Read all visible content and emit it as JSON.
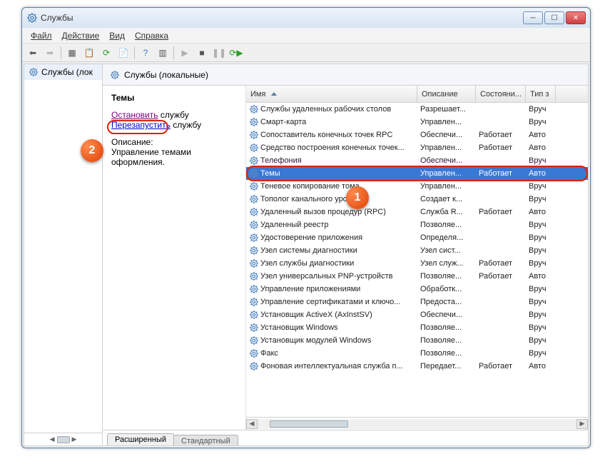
{
  "title": "Службы",
  "menu": [
    "Файл",
    "Действие",
    "Вид",
    "Справка"
  ],
  "leftpane": {
    "label": "Службы (лок"
  },
  "rp_header": "Службы (локальные)",
  "tabs": {
    "active": "Расширенный",
    "inactive": "Стандартный"
  },
  "detail": {
    "name": "Темы",
    "stop_text": "Остановить",
    "restart_text": "Перезапустить",
    "suffix": " службу",
    "desc_label": "Описание:",
    "desc": "Управление темами оформления."
  },
  "columns": [
    "Имя",
    "Описание",
    "Состояни...",
    "Тип з"
  ],
  "badges": {
    "b1": "1",
    "b2": "2"
  },
  "services": [
    {
      "name": "Службы удаленных рабочих столов",
      "desc": "Разрешает...",
      "stat": "",
      "type": "Вруч"
    },
    {
      "name": "Смарт-карта",
      "desc": "Управлен...",
      "stat": "",
      "type": "Вруч"
    },
    {
      "name": "Сопоставитель конечных точек RPC",
      "desc": "Обеспечи...",
      "stat": "Работает",
      "type": "Авто"
    },
    {
      "name": "Средство построения конечных точек...",
      "desc": "Управлен...",
      "stat": "Работает",
      "type": "Авто"
    },
    {
      "name": "Телефония",
      "desc": "Обеспечи...",
      "stat": "",
      "type": "Вруч"
    },
    {
      "name": "Темы",
      "desc": "Управлен...",
      "stat": "Работает",
      "type": "Авто",
      "selected": true
    },
    {
      "name": "Теневое копирование тома",
      "desc": "Управлен...",
      "stat": "",
      "type": "Вруч"
    },
    {
      "name": "Тополог канального уровня",
      "desc": "Создает к...",
      "stat": "",
      "type": "Вруч"
    },
    {
      "name": "Удаленный вызов процедур (RPC)",
      "desc": "Служба R...",
      "stat": "Работает",
      "type": "Авто"
    },
    {
      "name": "Удаленный реестр",
      "desc": "Позволяе...",
      "stat": "",
      "type": "Вруч"
    },
    {
      "name": "Удостоверение приложения",
      "desc": "Определя...",
      "stat": "",
      "type": "Вруч"
    },
    {
      "name": "Узел системы диагностики",
      "desc": "Узел сист...",
      "stat": "",
      "type": "Вруч"
    },
    {
      "name": "Узел службы диагностики",
      "desc": "Узел служ...",
      "stat": "Работает",
      "type": "Вруч"
    },
    {
      "name": "Узел универсальных PNP-устройств",
      "desc": "Позволяе...",
      "stat": "Работает",
      "type": "Авто"
    },
    {
      "name": "Управление приложениями",
      "desc": "Обработк...",
      "stat": "",
      "type": "Вруч"
    },
    {
      "name": "Управление сертификатами и ключо...",
      "desc": "Предоста...",
      "stat": "",
      "type": "Вруч"
    },
    {
      "name": "Установщик ActiveX (AxInstSV)",
      "desc": "Обеспечи...",
      "stat": "",
      "type": "Вруч"
    },
    {
      "name": "Установщик Windows",
      "desc": "Позволяе...",
      "stat": "",
      "type": "Вруч"
    },
    {
      "name": "Установщик модулей Windows",
      "desc": "Позволяе...",
      "stat": "",
      "type": "Вруч"
    },
    {
      "name": "Факс",
      "desc": "Позволяе...",
      "stat": "",
      "type": "Вруч"
    },
    {
      "name": "Фоновая интеллектуальная служба п...",
      "desc": "Передает...",
      "stat": "Работает",
      "type": "Авто"
    }
  ]
}
